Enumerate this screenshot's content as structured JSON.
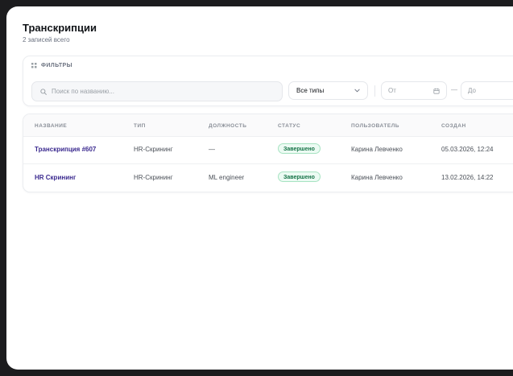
{
  "header": {
    "title": "Транскрипции",
    "subtitle": "2 записей всего"
  },
  "filters": {
    "title": "ФИЛЬТРЫ",
    "search_placeholder": "Поиск по названию...",
    "type_select_value": "Все типы",
    "date_from_placeholder": "От",
    "date_separator": "—",
    "date_to_placeholder": "До"
  },
  "table": {
    "columns": [
      "НАЗВАНИЕ",
      "ТИП",
      "ДОЛЖНОСТЬ",
      "СТАТУС",
      "ПОЛЬЗОВАТЕЛЬ",
      "СОЗДАН"
    ],
    "rows": [
      {
        "name": "Транскрипция #607",
        "type": "HR-Скрининг",
        "position": "—",
        "status": "Завершено",
        "user": "Карина Левченко",
        "created": "05.03.2026, 12:24"
      },
      {
        "name": "HR Скрининг",
        "type": "HR-Скрининг",
        "position": "ML engineer",
        "status": "Завершено",
        "user": "Карина Левченко",
        "created": "13.02.2026, 14:22"
      }
    ]
  },
  "colors": {
    "accent_link": "#3b2a8f",
    "status_success_bg": "#ecfbf3",
    "status_success_text": "#157347"
  },
  "icons": {
    "filters": "filter-icon",
    "search": "search-icon",
    "select": "chevron-down-icon",
    "date": "calendar-icon"
  }
}
